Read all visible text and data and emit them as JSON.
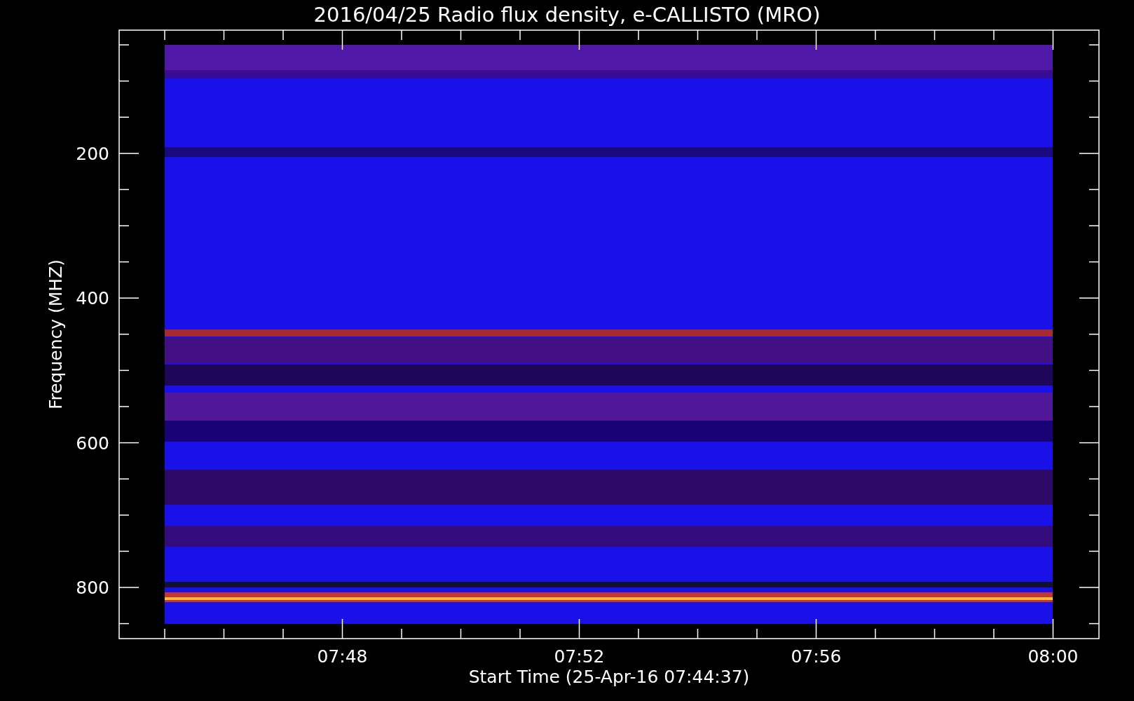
{
  "title": "2016/04/25  Radio flux density, e-CALLISTO (MRO)",
  "y_axis": {
    "label": "Frequency (MHZ)",
    "ticks": [
      "200",
      "400",
      "600",
      "800"
    ]
  },
  "x_axis": {
    "label": "Start Time (25-Apr-16 07:44:37)",
    "ticks": [
      "07:48",
      "07:52",
      "07:56",
      "08:00"
    ]
  }
}
